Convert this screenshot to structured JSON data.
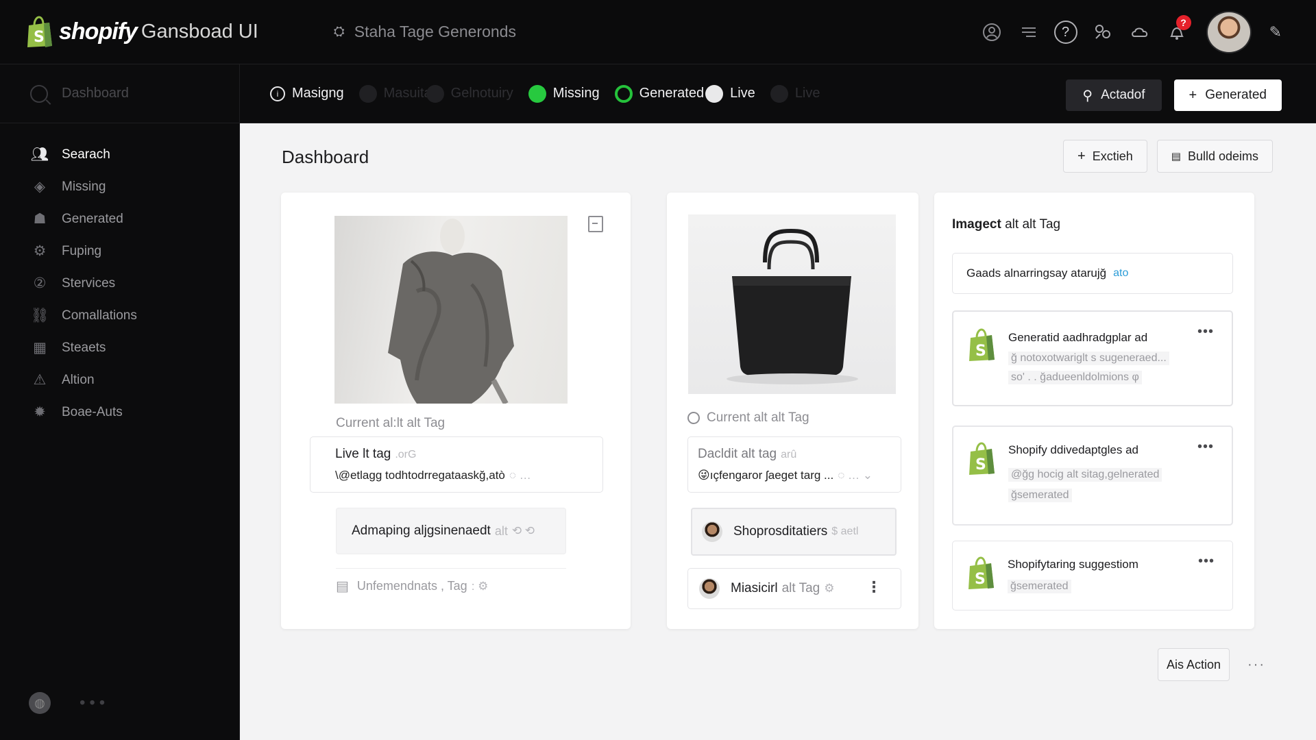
{
  "app": {
    "brand_name": "shopify",
    "brand_suffix": "Gansboad UI",
    "store_name": "Staha Tage Generonds",
    "notification_count": "?",
    "colors": {
      "accent_green": "#27c93f",
      "notification_red": "#e5212b",
      "shopify_green": "#95bf47"
    }
  },
  "header_icons": [
    "store-icon",
    "list-icon",
    "help-icon",
    "apps-icon",
    "cloud-icon",
    "bell-icon",
    "pin-icon"
  ],
  "sidebar": {
    "search_placeholder": "Dashboard",
    "items": [
      {
        "label": "Searach",
        "icon": "people-icon",
        "active": true
      },
      {
        "label": "Missing",
        "icon": "tag-icon"
      },
      {
        "label": "Generated",
        "icon": "users-icon"
      },
      {
        "label": "Fuping",
        "icon": "gear-icon"
      },
      {
        "label": "Stervices",
        "icon": "number-icon"
      },
      {
        "label": "Comallations",
        "icon": "link-icon"
      },
      {
        "label": "Steaets",
        "icon": "calendar-icon"
      },
      {
        "label": "Altion",
        "icon": "warning-icon"
      },
      {
        "label": "Boae-Auts",
        "icon": "settings-icon"
      }
    ],
    "footer_icon": "globe-icon"
  },
  "filters": {
    "chips": [
      {
        "label": "Masigng",
        "state": "outline"
      },
      {
        "label": "Masuita",
        "state": "dim"
      },
      {
        "label": "Gelnotuiry",
        "state": "dim"
      },
      {
        "label": "Missing",
        "state": "green"
      },
      {
        "label": "Generated",
        "state": "green-ring"
      },
      {
        "label": "Live",
        "state": "white"
      },
      {
        "label": "Live",
        "state": "dim"
      }
    ],
    "action_dark": "Actadof",
    "action_light": "Generated"
  },
  "main": {
    "title": "Dashboard",
    "head_actions": [
      "Exctieh",
      "Bulld odeims"
    ],
    "card1": {
      "current_label": "Current al:lt alt Tag",
      "field_title": "Live lt tag",
      "field_title_suffix": ".orG",
      "field_text": "\\@etlagg todhtodrregataaskğ,atò",
      "pill_text": "Admaping aljgsinenaedt",
      "pill_suffix": "alt",
      "unmanaged_text": "Unfemendnats , Tag"
    },
    "card2": {
      "current_label": "Current alt alt Tag",
      "field_title": "Dacldit alt tag",
      "field_title_suffix": "arû",
      "field_text": "😜ıçfengaror ʃaeget targ ...",
      "row1_text": "Shoprosditatiers",
      "row1_suffix": "$ aetl",
      "row2_text": "Miasicirl",
      "row2_suffix": "alt Tag"
    },
    "card3": {
      "title_bold": "Imagect",
      "title_rest": "alt alt Tag",
      "input_text": "Gaads alnarringsay atarujğ",
      "input_link": "ato",
      "suggestions": [
        {
          "title": "Generatid aadhradgplar ad",
          "lines": [
            "ğ notoxotwariglt s sugeneraed...",
            "so' .  .  ğadueenldolmions φ"
          ]
        },
        {
          "title": "Shopify ddivedaptgles ad",
          "lines": [
            "@ğg hocig alt sitag,gelnerated",
            "ğsemerated"
          ]
        },
        {
          "title": "Shopifytaring suggestiom",
          "lines": [
            "ğsemerated"
          ]
        }
      ]
    },
    "bottom_action": "Ais Action"
  }
}
